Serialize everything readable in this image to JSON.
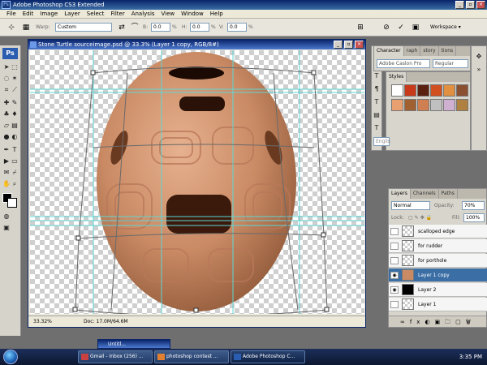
{
  "window": {
    "title": "Adobe Photoshop CS3 Extended"
  },
  "menu": [
    "File",
    "Edit",
    "Image",
    "Layer",
    "Select",
    "Filter",
    "Analysis",
    "View",
    "Window",
    "Help"
  ],
  "options": {
    "warp_label": "Warp:",
    "warp_value": "Custom",
    "h_label": "H:",
    "h_value": "0.0",
    "v_label": "V:",
    "v_value": "0.0",
    "workspace_label": "Workspace ▾"
  },
  "document": {
    "title": "Stone Turtle sourceimage.psd @ 33.3% (Layer 1 copy, RGB/8#)",
    "zoom": "33.32%",
    "doc_info": "Doc: 17.0M/64.6M"
  },
  "character_panel": {
    "tabs": [
      "Character",
      "raph",
      "story",
      "tions"
    ],
    "font_family": "Adobe Caslon Pro",
    "font_style": "Regular",
    "language": "Englis"
  },
  "styles_panel": {
    "tab": "Styles",
    "swatch_colors": [
      "#ffffff",
      "#c83a1a",
      "#5a2010",
      "#d05020",
      "#e09040",
      "#8a5030",
      "#e8a070",
      "#a06030",
      "#d08050",
      "#c0c0c0",
      "#d0b0d0",
      "#b08040"
    ]
  },
  "layers_panel": {
    "tabs": [
      "Layers",
      "Channels",
      "Paths"
    ],
    "blend_mode": "Normal",
    "opacity_label": "Opacity:",
    "opacity_value": "70%",
    "lock_label": "Lock:",
    "fill_label": "Fill:",
    "fill_value": "100%",
    "layers": [
      {
        "name": "scalloped edge",
        "visible": false,
        "selected": false
      },
      {
        "name": "for rudder",
        "visible": false,
        "selected": false
      },
      {
        "name": "for porthole",
        "visible": false,
        "selected": false
      },
      {
        "name": "Layer 1 copy",
        "visible": true,
        "selected": true
      },
      {
        "name": "Layer 2",
        "visible": true,
        "selected": false
      },
      {
        "name": "Layer 1",
        "visible": false,
        "selected": false
      }
    ]
  },
  "minimized_doc": "Untitl...",
  "taskbar": {
    "buttons": [
      "Gmail - Inbox (256) ...",
      "photoshop contest ...",
      "Adobe Photoshop C..."
    ],
    "clock": "3:35 PM"
  },
  "colors": {
    "title_bar": "#0a246a",
    "selected_layer": "#3a6ea5",
    "clay": "#c98a64"
  }
}
